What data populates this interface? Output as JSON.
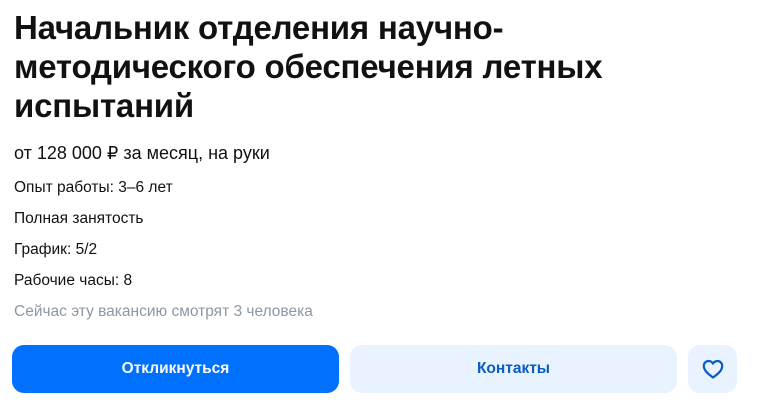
{
  "vacancy": {
    "title": "Начальник отделения научно-методического обеспечения летных испытаний",
    "salary": "от 128 000 ₽ за месяц, на руки",
    "experience": "Опыт работы: 3–6 лет",
    "employment": "Полная занятость",
    "schedule": "График: 5/2",
    "hours": "Рабочие часы: 8",
    "viewers": "Сейчас эту вакансию смотрят 3 человека"
  },
  "actions": {
    "apply_label": "Откликнуться",
    "contacts_label": "Контакты",
    "favorite_icon": "heart-icon"
  },
  "colors": {
    "primary": "#0070ff",
    "secondary_bg": "#e8f3ff",
    "secondary_text": "#0a5cc4",
    "muted_text": "#8c97a6"
  }
}
